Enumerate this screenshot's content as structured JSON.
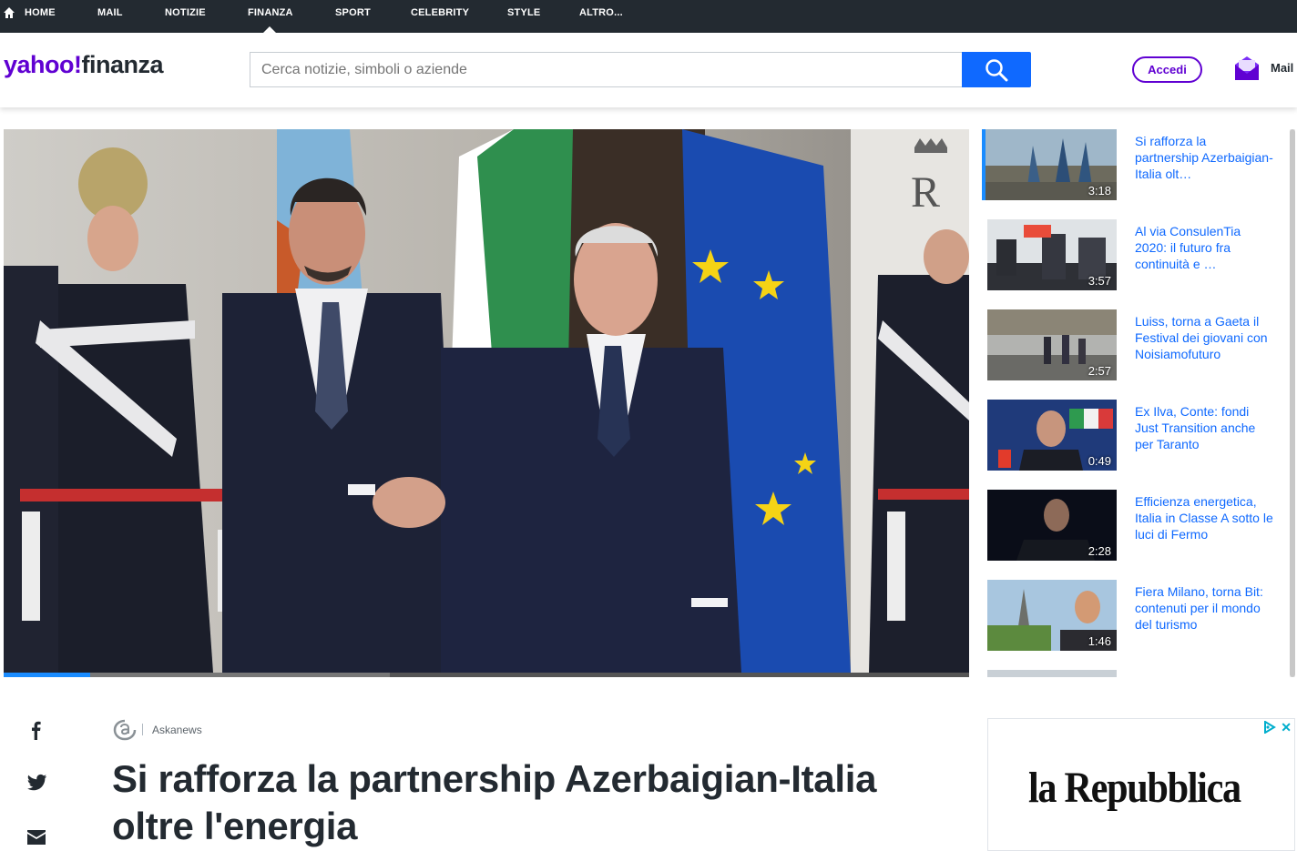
{
  "topnav": {
    "items": [
      "HOME",
      "MAIL",
      "NOTIZIE",
      "FINANZA",
      "SPORT",
      "CELEBRITY",
      "STYLE",
      "ALTRO..."
    ],
    "active": "FINANZA"
  },
  "header": {
    "logo_yahoo": "yahoo!",
    "logo_section": "finanza",
    "search_placeholder": "Cerca notizie, simboli o aziende",
    "signin_label": "Accedi",
    "mail_label": "Mail"
  },
  "playlist": [
    {
      "title": "Si rafforza la partnership Azerbaigian-Italia olt…",
      "duration": "3:18",
      "active": true
    },
    {
      "title": "Al via ConsulenTia 2020: il futuro fra continuità e …",
      "duration": "3:57"
    },
    {
      "title": "Luiss, torna a Gaeta il Festival dei giovani con Noisiamofuturo",
      "duration": "2:57"
    },
    {
      "title": "Ex Ilva, Conte: fondi Just Transition anche per Taranto",
      "duration": "0:49"
    },
    {
      "title": "Efficienza energetica, Italia in Classe A sotto le luci di Fermo",
      "duration": "2:28"
    },
    {
      "title": "Fiera Milano, torna Bit: contenuti per il mondo del turismo",
      "duration": "1:46"
    }
  ],
  "video": {
    "progress": 0.09,
    "buffered": 0.4
  },
  "article": {
    "source": "Askanews",
    "headline": "Si rafforza la partnership Azerbaigian-Italia oltre l'energia"
  },
  "ad": {
    "brand": "la Repubblica"
  },
  "colors": {
    "accent": "#6001d2",
    "link": "#0f69ff",
    "nav_bg": "#232a31",
    "progress": "#1a8cff"
  }
}
